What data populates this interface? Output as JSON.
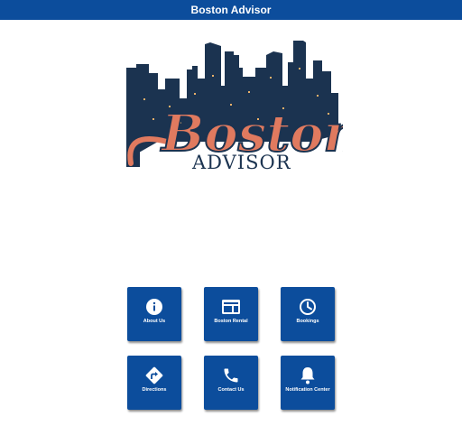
{
  "header": {
    "title": "Boston Advisor"
  },
  "logo": {
    "word1": "Boston",
    "word2": "ADVISOR"
  },
  "tiles": [
    {
      "label": "About Us",
      "icon": "info-icon"
    },
    {
      "label": "Boston Rental",
      "icon": "card-icon"
    },
    {
      "label": "Bookings",
      "icon": "clock-icon"
    },
    {
      "label": "Directions",
      "icon": "directions-icon"
    },
    {
      "label": "Contact Us",
      "icon": "phone-icon"
    },
    {
      "label": "Notification Center",
      "icon": "bell-icon"
    }
  ],
  "colors": {
    "primary": "#0c4d9c",
    "logo_navy": "#1b3350",
    "logo_salmon": "#e07a5f"
  }
}
